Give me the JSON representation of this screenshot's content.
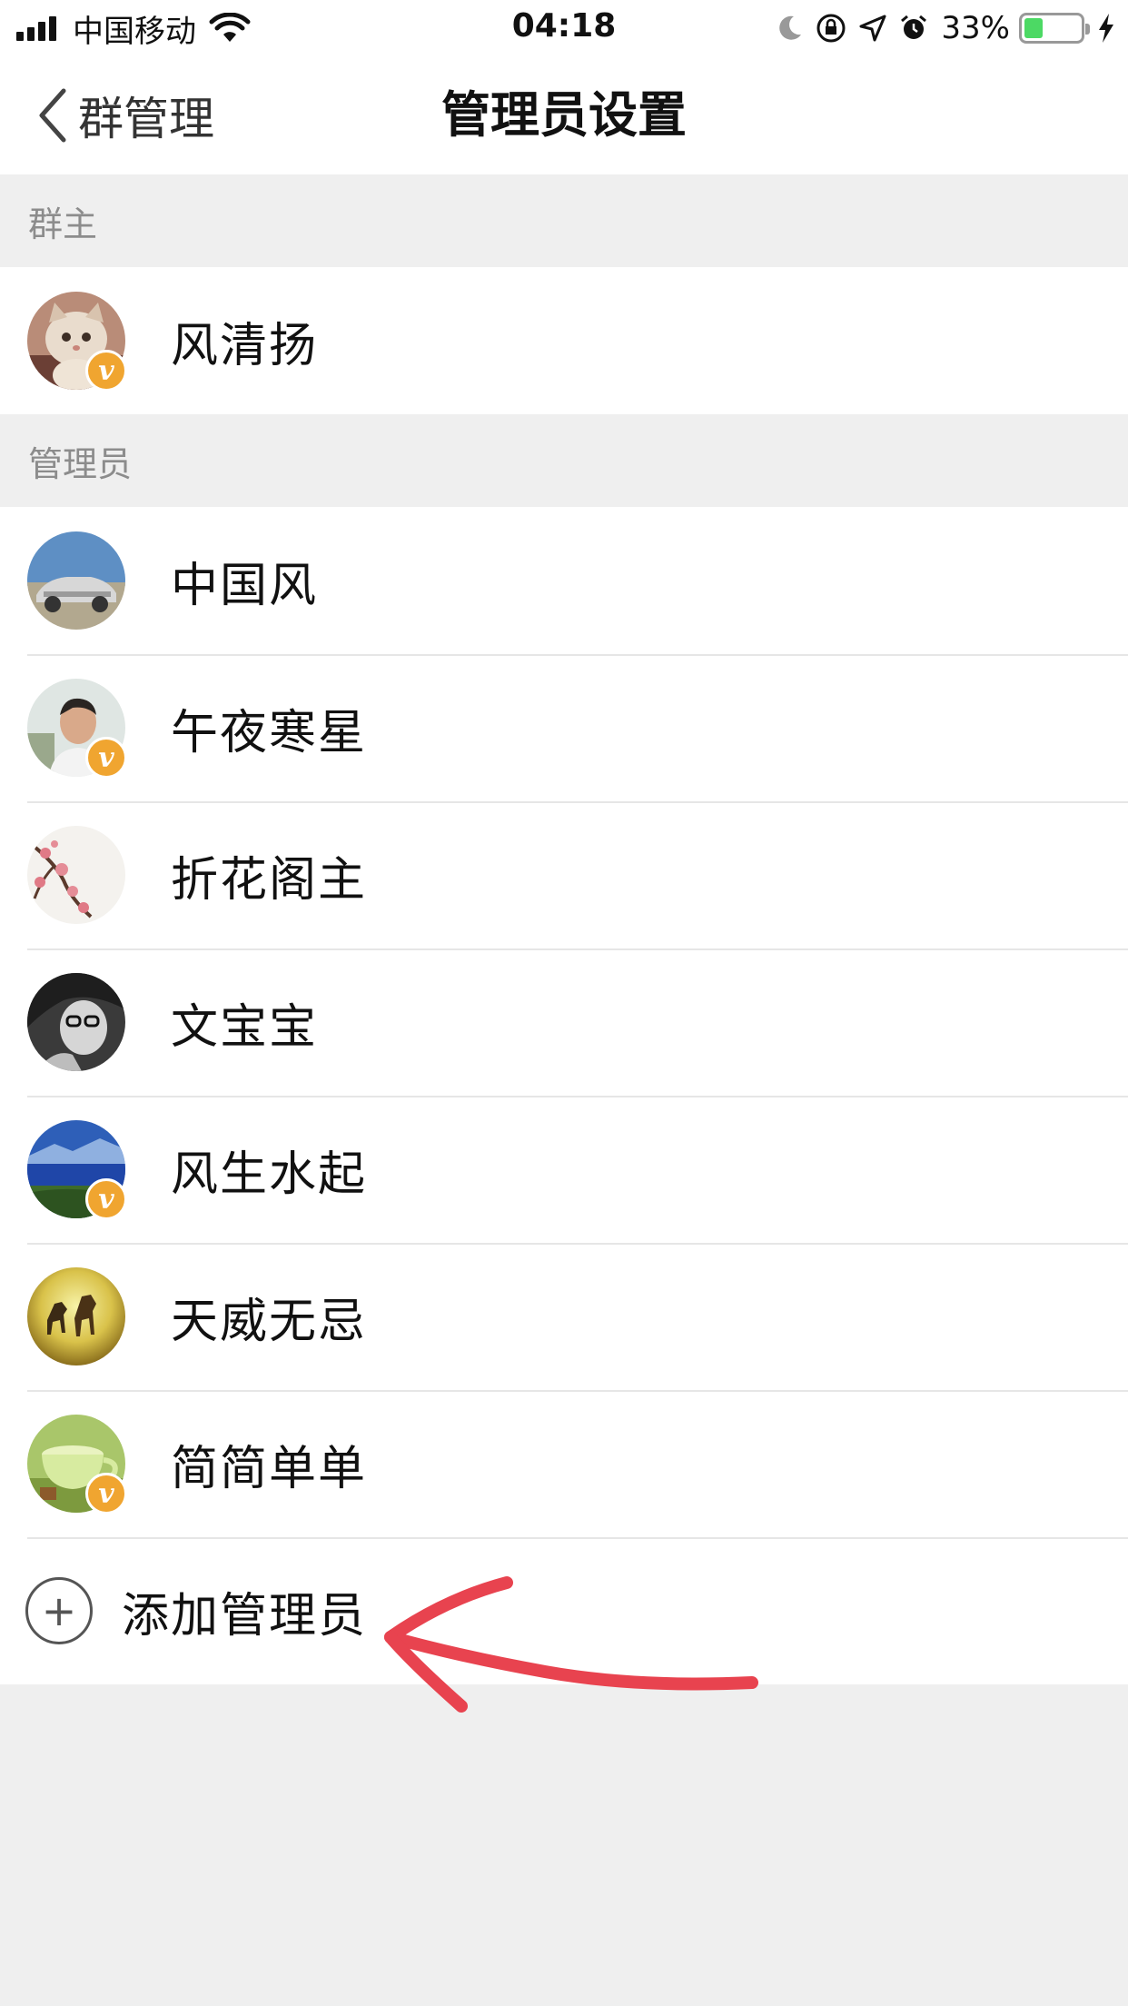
{
  "status_bar": {
    "carrier": "中国移动",
    "time": "04:18",
    "battery_percent": "33%",
    "battery_level": 0.33,
    "icons": [
      "signal-icon",
      "wifi-icon",
      "moon-icon",
      "rotation-lock-icon",
      "location-icon",
      "alarm-icon",
      "battery-icon",
      "charging-icon"
    ]
  },
  "nav": {
    "back_label": "群管理",
    "title": "管理员设置"
  },
  "owner_section": {
    "header": "群主",
    "members": [
      {
        "name": "风清扬",
        "verified": true,
        "avatar": "cat-avatar"
      }
    ]
  },
  "admin_section": {
    "header": "管理员",
    "members": [
      {
        "name": "中国风",
        "verified": false,
        "avatar": "car-avatar"
      },
      {
        "name": "午夜寒星",
        "verified": true,
        "avatar": "man-avatar"
      },
      {
        "name": "折花阁主",
        "verified": false,
        "avatar": "plum-blossom-avatar"
      },
      {
        "name": "文宝宝",
        "verified": false,
        "avatar": "bw-portrait-avatar"
      },
      {
        "name": "风生水起",
        "verified": true,
        "avatar": "landscape-avatar"
      },
      {
        "name": "天威无忌",
        "verified": false,
        "avatar": "horses-avatar"
      },
      {
        "name": "简简单单",
        "verified": true,
        "avatar": "tea-cup-avatar"
      }
    ],
    "add_label": "添加管理员"
  },
  "badge_letter": "v",
  "colors": {
    "badge": "#f0a530",
    "annotation_arrow": "#e8434f",
    "battery_fill": "#4cd964"
  }
}
